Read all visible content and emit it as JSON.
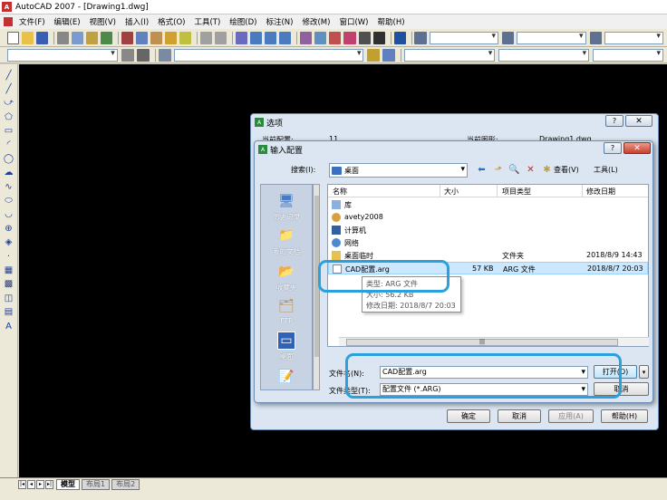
{
  "window": {
    "title": "AutoCAD 2007 - [Drawing1.dwg]"
  },
  "menu": [
    "文件(F)",
    "编辑(E)",
    "视图(V)",
    "插入(I)",
    "格式(O)",
    "工具(T)",
    "绘图(D)",
    "标注(N)",
    "修改(M)",
    "窗口(W)",
    "帮助(H)"
  ],
  "layout_tabs": [
    "模型",
    "布局1",
    "布局2"
  ],
  "options_dialog": {
    "title": "选项",
    "profile_label": "当前配置:",
    "profile_value": "11",
    "drawing_label": "当前图形:",
    "drawing_value": "Drawing1.dwg",
    "ok": "确定",
    "cancel": "取消",
    "apply": "应用(A)",
    "help": "帮助(H)",
    "help_btn": "?",
    "close_btn": "✕"
  },
  "import_dialog": {
    "title": "输入配置",
    "look_in_label": "搜索(I):",
    "look_in_value": "桌面",
    "view_label": "查看(V)",
    "tools_label": "工具(L)",
    "help_btn": "?",
    "close_btn": "✕",
    "places": [
      "历史记录",
      "我的文档",
      "收藏夹",
      "FTP",
      "桌面"
    ],
    "columns": {
      "name": "名称",
      "size": "大小",
      "type": "项目类型",
      "modified": "修改日期"
    },
    "files": [
      {
        "name": "库",
        "size": "",
        "type": "",
        "modified": ""
      },
      {
        "name": "avety2008",
        "size": "",
        "type": "",
        "modified": ""
      },
      {
        "name": "计算机",
        "size": "",
        "type": "",
        "modified": ""
      },
      {
        "name": "网络",
        "size": "",
        "type": "",
        "modified": ""
      },
      {
        "name": "桌面临时",
        "size": "",
        "type": "文件夹",
        "modified": "2018/8/9 14:43"
      },
      {
        "name": "CAD配置.arg",
        "size": "57 KB",
        "type": "ARG 文件",
        "modified": "2018/8/7 20:03"
      }
    ],
    "tooltip": {
      "type": "类型: ARG 文件",
      "size": "大小: 56.2 KB",
      "modified": "修改日期: 2018/8/7 20:03"
    },
    "filename_label": "文件名(N):",
    "filename_value": "CAD配置.arg",
    "filetype_label": "文件类型(T):",
    "filetype_value": "配置文件 (*.ARG)",
    "open": "打开(O)",
    "cancel": "取消"
  },
  "colors": {
    "annotation": "#2aa0dc",
    "canvas": "#000000",
    "selected_row": "#cce8ff"
  }
}
